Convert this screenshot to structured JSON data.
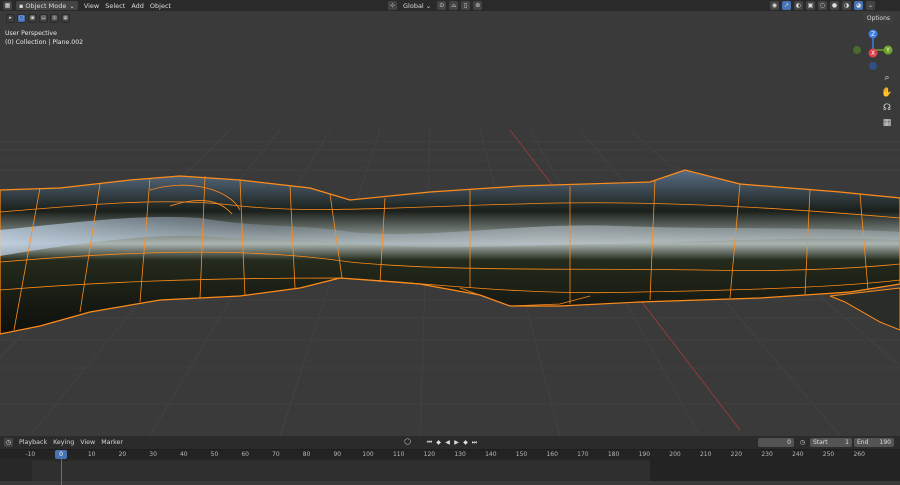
{
  "header": {
    "mode": "Object Mode",
    "menus": [
      "View",
      "Select",
      "Add",
      "Object"
    ],
    "transform_orientation": "Global",
    "options_label": "Options"
  },
  "viewport": {
    "view_name": "User Perspective",
    "collection_line": "(0) Collection | Plane.002"
  },
  "gizmo": {
    "z": "Z",
    "y": "Y",
    "x": "X"
  },
  "colors": {
    "accent": "#4772b3",
    "selection_outline": "#ff8c1a",
    "axis_x": "#e0404a",
    "axis_y": "#6fa52b",
    "axis_z": "#3f7ee0"
  },
  "timeline": {
    "menus": [
      "Playback",
      "Keying",
      "View",
      "Marker"
    ],
    "current_frame": "0",
    "start_label": "Start",
    "start": "1",
    "end_label": "End",
    "end": "190",
    "ticks": [
      "-10",
      "0",
      "10",
      "20",
      "30",
      "40",
      "50",
      "60",
      "70",
      "80",
      "90",
      "100",
      "110",
      "120",
      "130",
      "140",
      "150",
      "160",
      "170",
      "180",
      "190",
      "200",
      "210",
      "220",
      "230",
      "240",
      "250",
      "260"
    ]
  }
}
